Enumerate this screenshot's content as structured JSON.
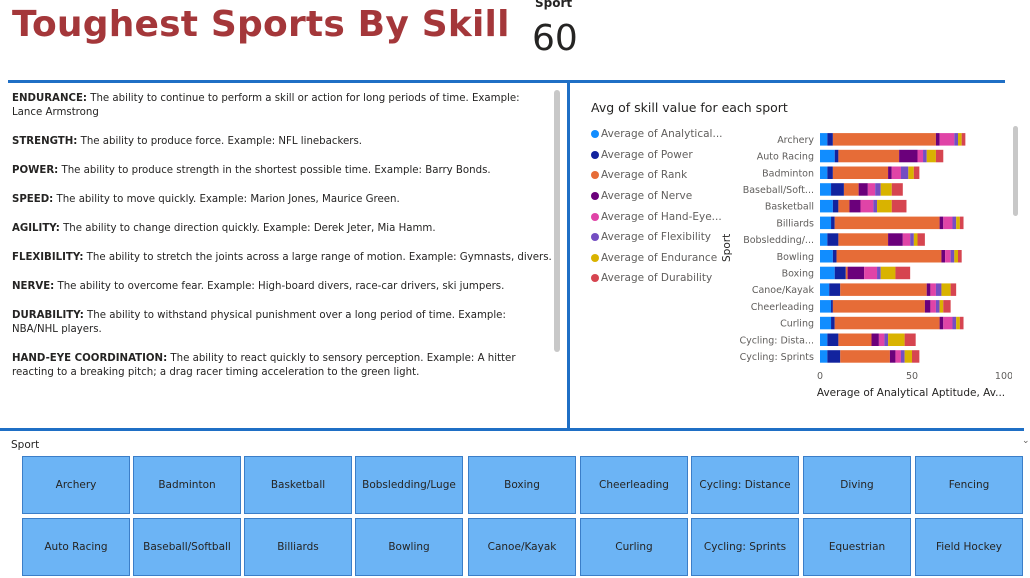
{
  "page": {
    "title": "Toughest Sports By Skill",
    "card_label": "Sport",
    "card_value": "60"
  },
  "colors": {
    "accent_line": "#1f6fc5",
    "title": "#a4373a",
    "tile_fill": "#6cb4f5"
  },
  "definitions": [
    {
      "term": "ENDURANCE:",
      "text": " The ability to continue to perform a skill or action for long periods of time. Example: Lance Armstrong"
    },
    {
      "term": "STRENGTH:",
      "text": " The ability to produce force. Example: NFL linebackers."
    },
    {
      "term": "POWER:",
      "text": " The ability to produce strength in the shortest possible time. Example: Barry Bonds."
    },
    {
      "term": "SPEED:",
      "text": " The ability to move quickly. Example: Marion Jones, Maurice Green."
    },
    {
      "term": "AGILITY:",
      "text": " The ability to change direction quickly. Example: Derek Jeter, Mia Hamm."
    },
    {
      "term": "FLEXIBILITY:",
      "text": " The ability to stretch the joints across a large range of motion. Example: Gymnasts, divers."
    },
    {
      "term": "NERVE:",
      "text": " The ability to overcome fear. Example: High-board divers, race-car drivers, ski jumpers."
    },
    {
      "term": "DURABILITY:",
      "text": " The ability to withstand physical punishment over a long period of time. Example: NBA/NHL players."
    },
    {
      "term": "HAND-EYE COORDINATION:",
      "text": " The ability to react quickly to sensory perception. Example: A hitter reacting to a breaking pitch; a drag racer timing acceleration to the green light."
    }
  ],
  "chart_data": {
    "type": "bar",
    "stacked": true,
    "orientation": "horizontal",
    "title": "Avg of skill value for each sport",
    "ylabel": "Sport",
    "xlabel": "Average of Analytical Aptitude, Av...",
    "xlim": [
      0,
      100
    ],
    "xticks": [
      0,
      50,
      100
    ],
    "categories": [
      "Archery",
      "Auto Racing",
      "Badminton",
      "Baseball/Soft...",
      "Basketball",
      "Billiards",
      "Bobsledding/...",
      "Bowling",
      "Boxing",
      "Canoe/Kayak",
      "Cheerleading",
      "Curling",
      "Cycling: Dista...",
      "Cycling: Sprints"
    ],
    "series": [
      {
        "name": "Average of Analytical...",
        "color": "#118dff",
        "values": [
          4,
          8,
          4,
          6,
          7,
          6,
          4,
          7,
          8,
          5,
          6,
          6,
          4,
          4
        ]
      },
      {
        "name": "Average of Power",
        "color": "#12239e",
        "values": [
          3,
          2,
          3,
          7,
          3,
          2,
          6,
          2,
          6,
          6,
          1,
          2,
          6,
          7
        ]
      },
      {
        "name": "Average of Rank",
        "color": "#e66c37",
        "values": [
          56,
          33,
          30,
          8,
          6,
          57,
          27,
          57,
          1,
          47,
          50,
          57,
          18,
          27
        ]
      },
      {
        "name": "Average of Nerve",
        "color": "#6b007b",
        "values": [
          2,
          10,
          2,
          5,
          6,
          2,
          8,
          2,
          9,
          2,
          3,
          2,
          4,
          3
        ]
      },
      {
        "name": "Average of Hand-Eye...",
        "color": "#e044a7",
        "values": [
          8,
          3,
          5,
          4,
          7,
          5,
          4,
          3,
          7,
          3,
          3,
          5,
          3,
          3
        ]
      },
      {
        "name": "Average of Flexibility",
        "color": "#744ec2",
        "values": [
          2,
          2,
          4,
          3,
          2,
          2,
          2,
          2,
          2,
          3,
          2,
          2,
          2,
          2
        ]
      },
      {
        "name": "Average of Endurance",
        "color": "#d9b300",
        "values": [
          2,
          5,
          3,
          6,
          8,
          2,
          2,
          2,
          8,
          5,
          2,
          2,
          9,
          4
        ]
      },
      {
        "name": "Average of Durability",
        "color": "#d64550",
        "values": [
          2,
          4,
          3,
          6,
          8,
          2,
          4,
          2,
          8,
          3,
          4,
          2,
          6,
          4
        ]
      }
    ]
  },
  "slicer": {
    "title": "Sport",
    "row1": [
      "Archery",
      "Badminton",
      "Basketball",
      "Bobsledding/Luge",
      "Boxing",
      "Cheerleading",
      "Cycling: Distance",
      "Diving",
      "Fencing"
    ],
    "row2": [
      "Auto Racing",
      "Baseball/Softball",
      "Billiards",
      "Bowling",
      "Canoe/Kayak",
      "Curling",
      "Cycling: Sprints",
      "Equestrian",
      "Field Hockey"
    ]
  }
}
